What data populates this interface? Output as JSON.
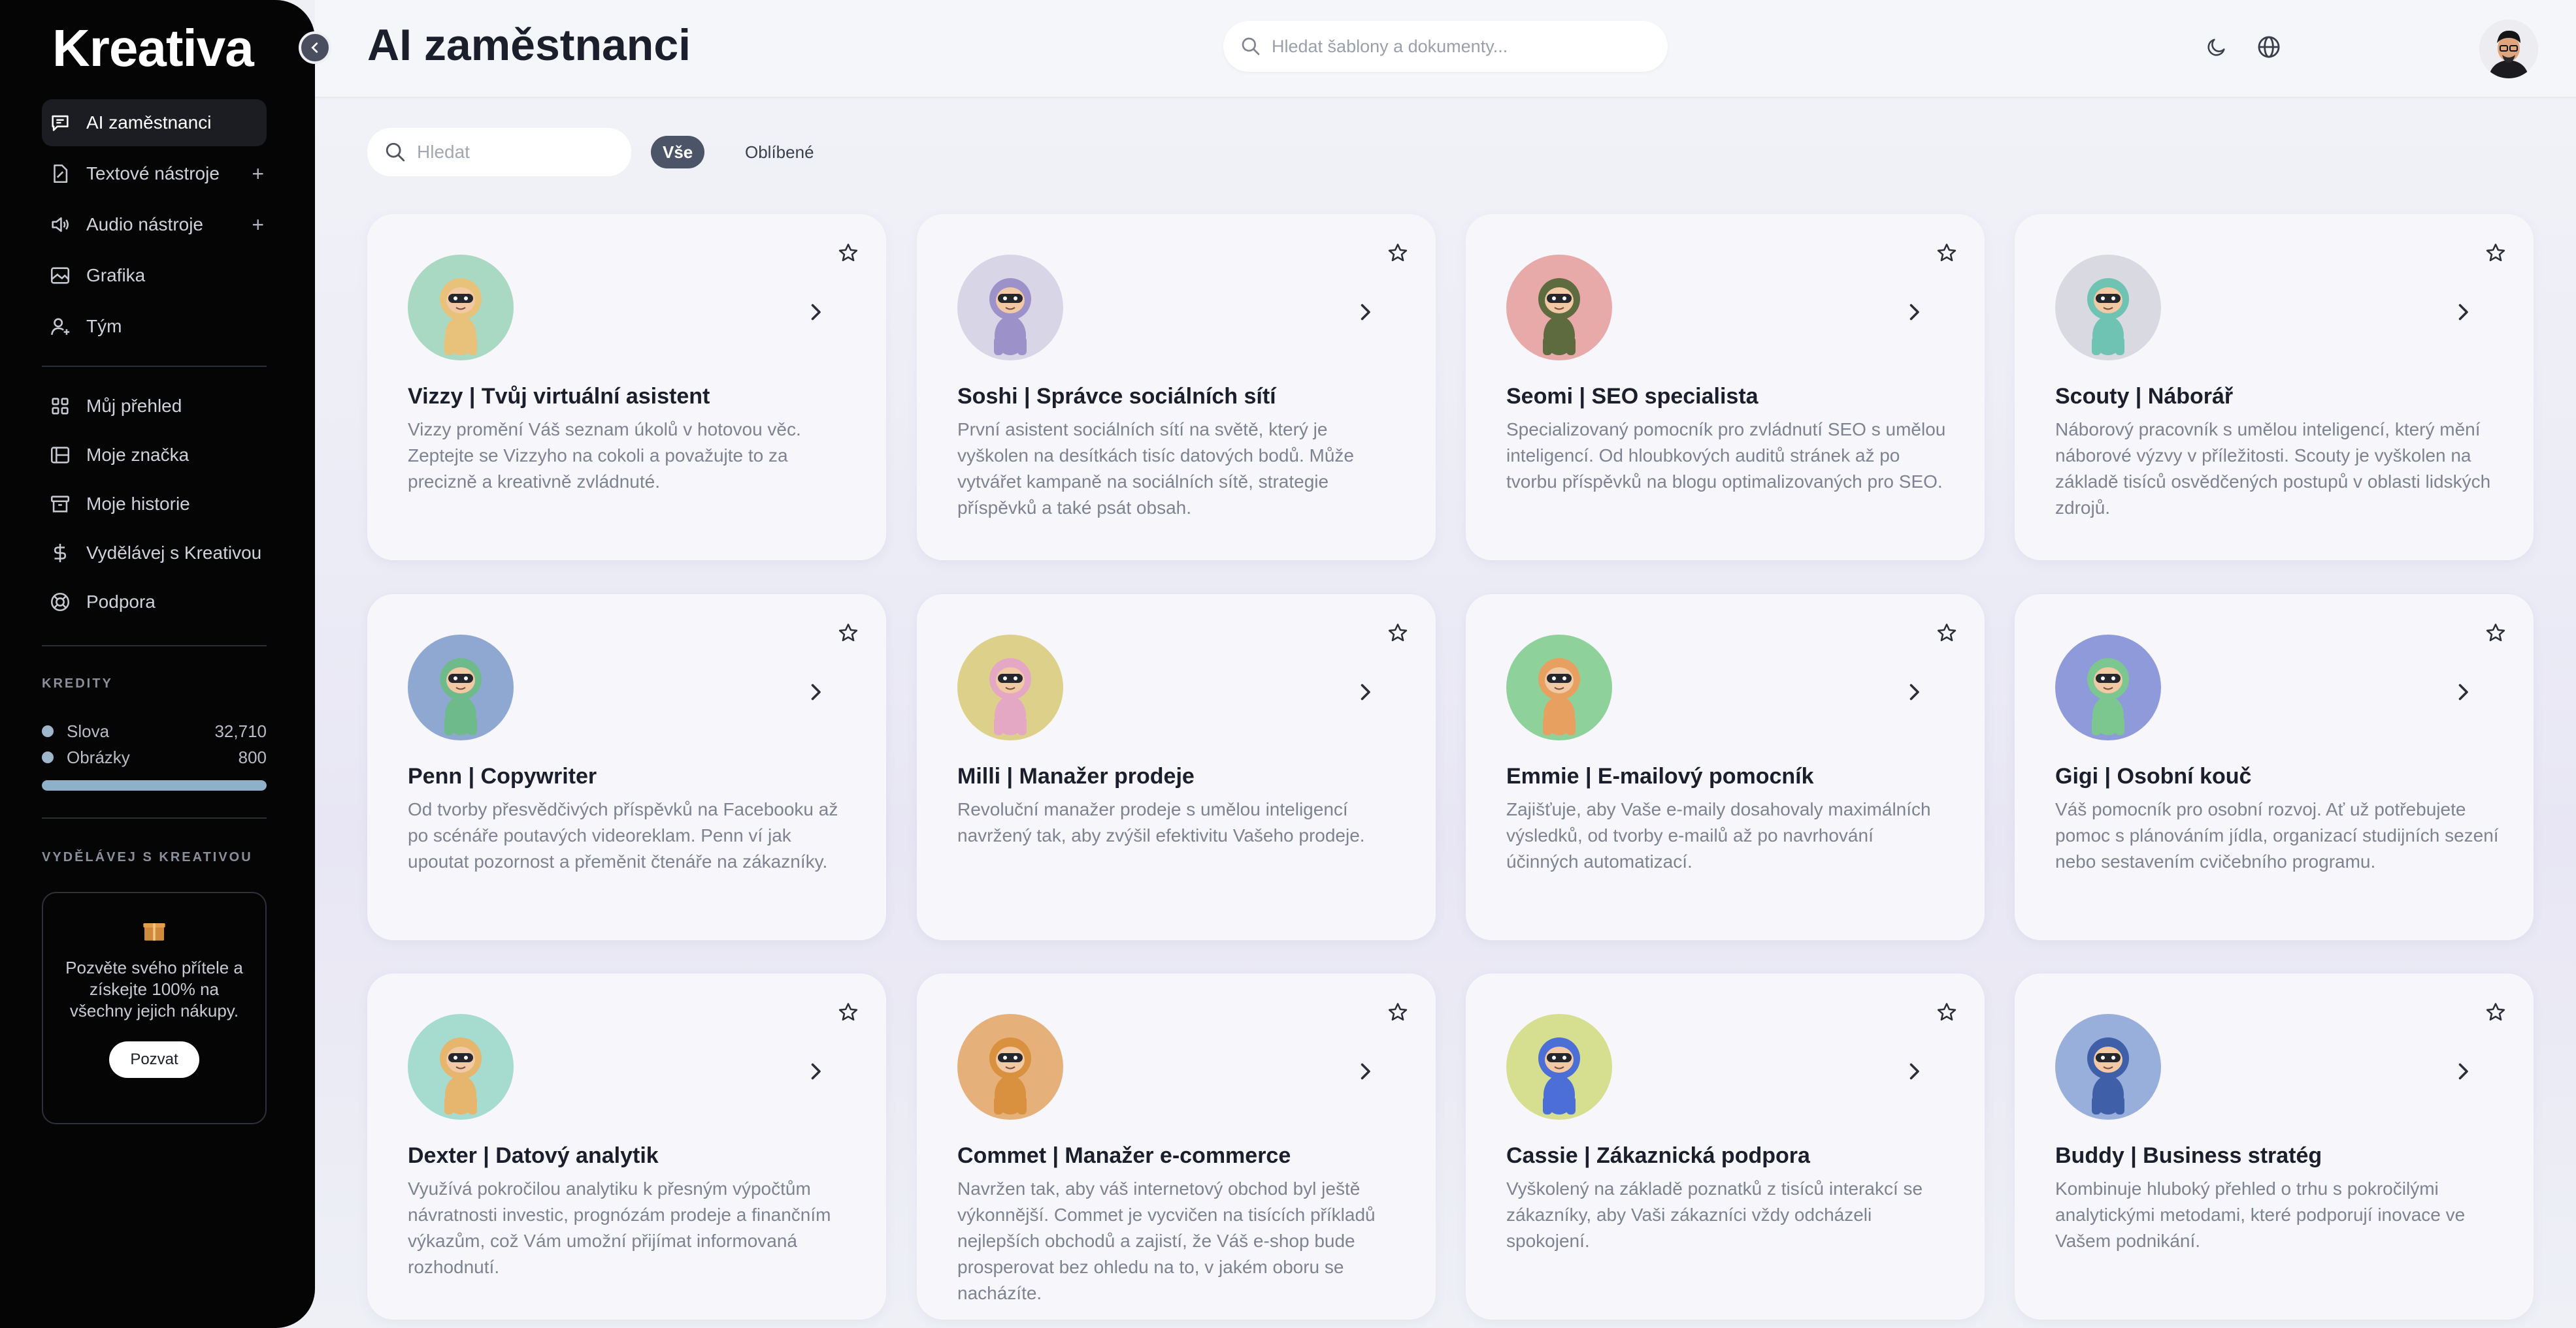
{
  "sidebar": {
    "logo": "Kreativa",
    "nav": [
      {
        "label": "AI zaměstnanci",
        "icon": "chat-icon",
        "active": true
      },
      {
        "label": "Textové nástroje",
        "icon": "document-icon",
        "expand": "+"
      },
      {
        "label": "Audio nástroje",
        "icon": "speaker-icon",
        "expand": "+"
      },
      {
        "label": "Grafika",
        "icon": "image-icon"
      },
      {
        "label": "Tým",
        "icon": "user-add-icon"
      }
    ],
    "nav2": [
      {
        "label": "Můj přehled",
        "icon": "grid-icon"
      },
      {
        "label": "Moje značka",
        "icon": "brand-icon"
      },
      {
        "label": "Moje historie",
        "icon": "archive-icon"
      },
      {
        "label": "Vydělávej s Kreativou",
        "icon": "dollar-icon"
      },
      {
        "label": "Podpora",
        "icon": "lifebuoy-icon"
      }
    ],
    "credits_label": "KREDITY",
    "credits": [
      {
        "label": "Slova",
        "value": "32,710"
      },
      {
        "label": "Obrázky",
        "value": "800"
      }
    ],
    "credits_fill": 1.0,
    "earn_label": "VYDĚLÁVEJ S KREATIVOU",
    "invite_text": "Pozvěte svého přítele a získejte 100% na všechny jejich nákupy.",
    "invite_button": "Pozvat"
  },
  "header": {
    "title": "AI zaměstnanci",
    "search_placeholder": "Hledat šablony a dokumenty..."
  },
  "filters": {
    "search_placeholder": "Hledat",
    "tabs": [
      "Vše",
      "Oblíbené"
    ]
  },
  "cards": [
    {
      "name": "Vizzy | Tvůj virtuální asistent",
      "desc": "Vizzy promění Váš seznam úkolů v hotovou věc. Zeptejte se Vizzyho na cokoli a považujte to za precizně a kreativně zvládnuté.",
      "bg": "#a9d8c3",
      "suit": "#e8c27a"
    },
    {
      "name": "Soshi | Správce sociálních sítí",
      "desc": "První asistent sociálních sítí na světě, který je vyškolen na desítkách tisíc datových bodů. Může vytvářet kampaně na sociálních sítě, strategie příspěvků a také psát obsah.",
      "bg": "#d7d5e6",
      "suit": "#9c92c9"
    },
    {
      "name": "Seomi | SEO specialista",
      "desc": "Specializovaný pomocník pro zvládnutí SEO s umělou inteligencí. Od hloubkových auditů stránek až po tvorbu příspěvků na blogu optimalizovaných pro SEO.",
      "bg": "#e8a9a9",
      "suit": "#5d6b3f"
    },
    {
      "name": "Scouty | Náborář",
      "desc": "Náborový pracovník s umělou inteligencí, který mění náborové výzvy v příležitosti. Scouty je vyškolen na základě tisíců osvědčených postupů v oblasti lidských zdrojů.",
      "bg": "#d9d9e2",
      "suit": "#6fc3b2"
    },
    {
      "name": "Penn | Copywriter",
      "desc": "Od tvorby přesvědčivých příspěvků na Facebooku až po scénáře poutavých videoreklam. Penn ví jak upoutat pozornost a přeměnit čtenáře na zákazníky.",
      "bg": "#8fa8d1",
      "suit": "#6fba8a"
    },
    {
      "name": "Milli | Manažer prodeje",
      "desc": "Revoluční manažer prodeje s umělou inteligencí navržený tak, aby zvýšil efektivitu Vašeho prodeje.",
      "bg": "#ddd08a",
      "suit": "#e4a8c4"
    },
    {
      "name": "Emmie | E-mailový pomocník",
      "desc": "Zajišťuje, aby Vaše e-maily dosahovaly maximálních výsledků, od tvorby e-mailů až po navrhování účinných automatizací.",
      "bg": "#8fd19b",
      "suit": "#e8a060"
    },
    {
      "name": "Gigi | Osobní kouč",
      "desc": "Váš pomocník pro osobní rozvoj. Ať už potřebujete pomoc s plánováním jídla, organizací studijních sezení nebo sestavením cvičebního programu.",
      "bg": "#8f9adb",
      "suit": "#7cc68f"
    },
    {
      "name": "Dexter | Datový analytik",
      "desc": "Využívá pokročilou analytiku k přesným výpočtům návratnosti investic, prognózám prodeje a finančním výkazům, což Vám umožní přijímat informovaná rozhodnutí.",
      "bg": "#a6dccf",
      "suit": "#e6b56e"
    },
    {
      "name": "Commet | Manažer e-commerce",
      "desc": "Navržen tak, aby váš internetový obchod byl ještě výkonnější. Commet je vycvičen na tisících příkladů nejlepších obchodů a zajistí, že Váš e-shop bude prosperovat bez ohledu na to, v jakém oboru se nacházíte.",
      "bg": "#e5b07a",
      "suit": "#d9913f"
    },
    {
      "name": "Cassie | Zákaznická podpora",
      "desc": "Vyškolený na základě poznatků z tisíců interakcí se zákazníky, aby Vaši zákazníci vždy odcházeli spokojení.",
      "bg": "#d6df8f",
      "suit": "#4b6fd6"
    },
    {
      "name": "Buddy | Business stratég",
      "desc": "Kombinuje hluboký přehled o trhu s pokročilými analytickými metodami, které podporují inovace ve Vašem podnikání.",
      "bg": "#98aedb",
      "suit": "#3f5fa8"
    }
  ]
}
